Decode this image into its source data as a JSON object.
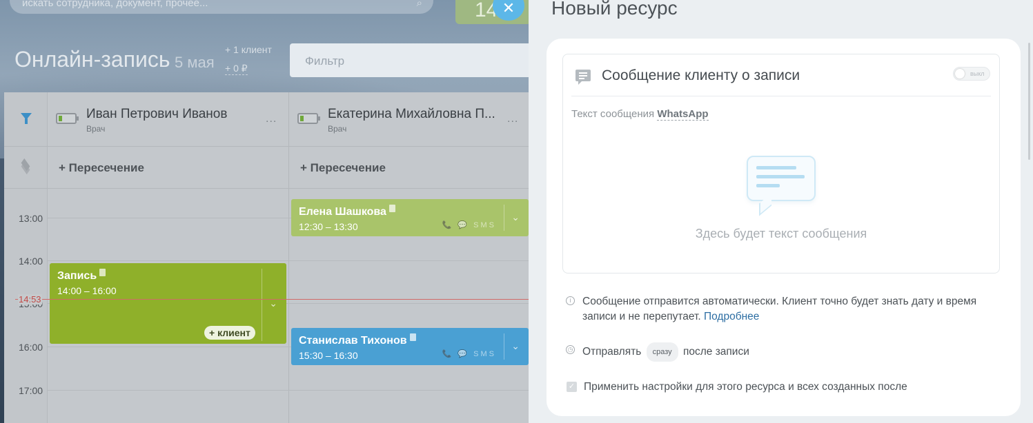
{
  "top": {
    "search_placeholder": "искать сотрудника, документ, прочее...",
    "green_button_text": "14",
    "close_symbol": "✕"
  },
  "header": {
    "title": "Онлайн-запись",
    "date": "5 мая",
    "clients_stat": "+ 1 клиент",
    "money_stat": "+ 0 ₽",
    "filter_placeholder": "Фильтр"
  },
  "calendar": {
    "resources": [
      {
        "name": "Иван Петрович Иванов",
        "role": "Врач"
      },
      {
        "name": "Екатерина Михайловна П...",
        "role": "Врач"
      }
    ],
    "more_symbol": "...",
    "intersection_label": "+ Пересечение",
    "hours": [
      "13:00",
      "14:00",
      "15:00",
      "16:00",
      "17:00"
    ],
    "now_time": "14:53",
    "appointments": [
      {
        "title": "Елена Шашкова",
        "time": "12:30 – 13:30",
        "icons": "📞 💬 SMS"
      },
      {
        "title": "Запись",
        "time": "14:00 – 16:00",
        "add_client": "+ клиент"
      },
      {
        "title": "Станислав Тихонов",
        "time": "15:30 – 16:30",
        "icons": "📞 💬 SMS"
      }
    ],
    "colors": {
      "green_light": "#a9c46a",
      "green": "#8fb02a",
      "blue": "#4aa0d3"
    }
  },
  "panel": {
    "title": "Новый ресурс",
    "section_title": "Сообщение клиенту о записи",
    "toggle_label": "выкл",
    "message_label_prefix": "Текст сообщения",
    "message_channel": "WhatsApp",
    "placeholder_text": "Здесь будет текст сообщения",
    "info_text": "Сообщение отправится автоматически. Клиент точно будет знать дату и время записи и не перепутает.",
    "info_link": "Подробнее",
    "send_prefix": "Отправлять",
    "send_when": "сразу",
    "send_suffix": "после записи",
    "apply_label": "Применить настройки для этого ресурса и всех созданных после",
    "apply_checked": true
  }
}
